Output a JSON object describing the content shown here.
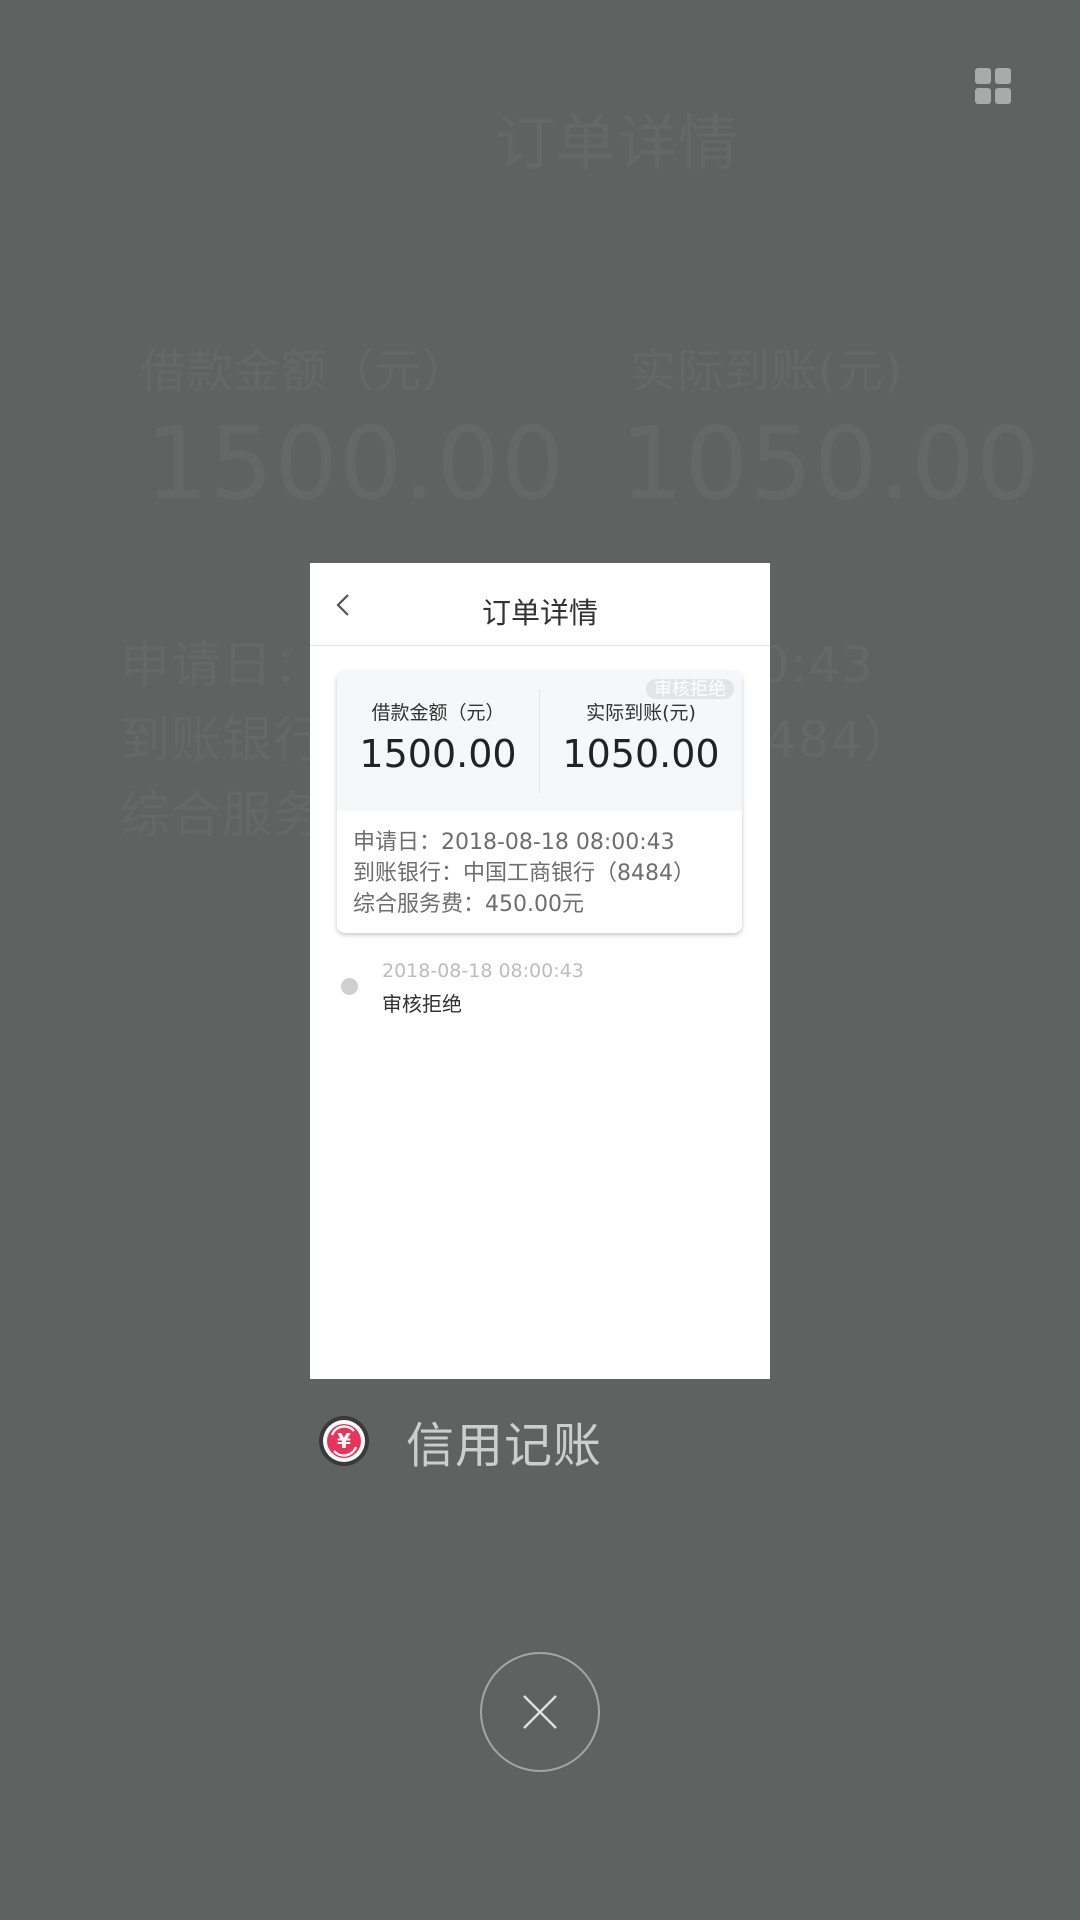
{
  "background_app": {
    "title": "订单详情",
    "label_left": "借款金额（元）",
    "label_right": "实际到账(元)",
    "amount_left": "1500.00",
    "amount_right": "1050.00",
    "line1": "申请日：2018-08-18 08:00:43",
    "line2": "到账银行：中国工商银行（8484）",
    "line3": "综合服务费：450.00元"
  },
  "recent_card": {
    "title": "订单详情",
    "status_badge": "审核拒绝",
    "loan_amount_label": "借款金额（元）",
    "loan_amount": "1500.00",
    "received_label": "实际到账(元)",
    "received_amount": "1050.00",
    "apply_date": "申请日：2018-08-18 08:00:43",
    "bank": "到账银行：中国工商银行（8484）",
    "service_fee": "综合服务费：450.00元",
    "timeline": [
      {
        "time": "2018-08-18 08:00:43",
        "status": "审核拒绝"
      }
    ]
  },
  "app": {
    "name": "信用记账",
    "icon": "yuan-refresh-icon"
  },
  "controls": {
    "grid_icon": "grid-icon",
    "close_icon": "close-icon"
  },
  "colors": {
    "overlay_bg": "#606262",
    "app_icon_accent": "#e8345a"
  }
}
